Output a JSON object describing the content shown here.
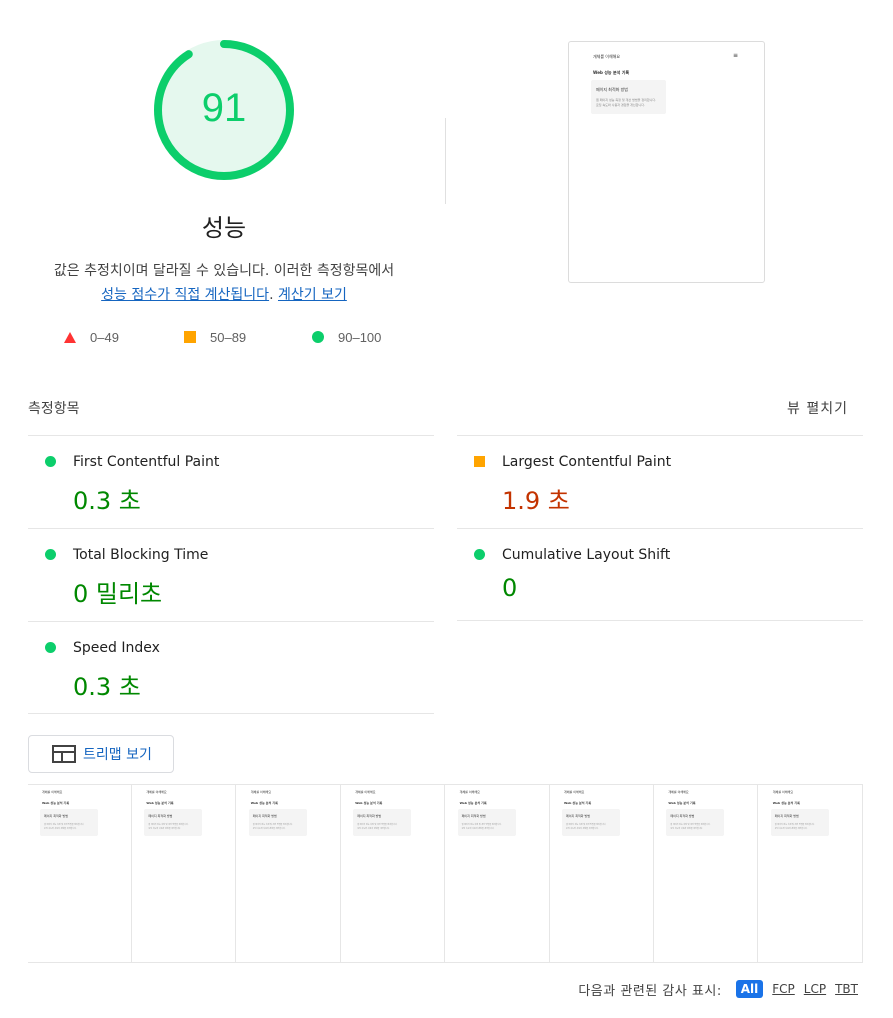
{
  "score": {
    "value": "91",
    "fraction": 0.91,
    "color": "#0cce6b"
  },
  "category": {
    "title": "성능"
  },
  "description": {
    "text": "값은 추정치이며 달라질 수 있습니다. 이러한 측정항목에서",
    "link1": "성능 점수가 직접 계산됩니다",
    "separator": ".",
    "link2": "계산기 보기"
  },
  "legend": [
    {
      "shape": "triangle",
      "range": "0–49",
      "color": "#ff3333"
    },
    {
      "shape": "square",
      "range": "50–89",
      "color": "#ffa400"
    },
    {
      "shape": "circle",
      "range": "90–100",
      "color": "#0cce6b"
    }
  ],
  "screenshot_page": {
    "header": "개체를 이해해요",
    "menu_icon": "hamburger-icon",
    "subtitle": "Web 성능 분석 기록",
    "card_title": "페이지 최적화 방법",
    "card_line1": "웹 페이지 성능 측정 및 개선 방법을 정리합니다.",
    "card_line2": "로딩 속도와 사용자 경험을 개선합니다."
  },
  "metrics": {
    "title": "측정항목",
    "toggle": "뷰 펼치기",
    "items": [
      {
        "name": "First Contentful Paint",
        "value": "0.3 초",
        "rating": "pass"
      },
      {
        "name": "Largest Contentful Paint",
        "value": "1.9 초",
        "rating": "average"
      },
      {
        "name": "Total Blocking Time",
        "value": "0 밀리초",
        "rating": "pass"
      },
      {
        "name": "Cumulative Layout Shift",
        "value": "0",
        "rating": "pass"
      },
      {
        "name": "Speed Index",
        "value": "0.3 초",
        "rating": "pass"
      }
    ]
  },
  "treemap": {
    "label": "트리맵 보기",
    "icon": "treemap-icon"
  },
  "filmstrip": {
    "frame_count": 8
  },
  "filter": {
    "label": "다음과 관련된 감사 표시:",
    "options": [
      "All",
      "FCP",
      "LCP",
      "TBT"
    ],
    "selected": "All"
  }
}
